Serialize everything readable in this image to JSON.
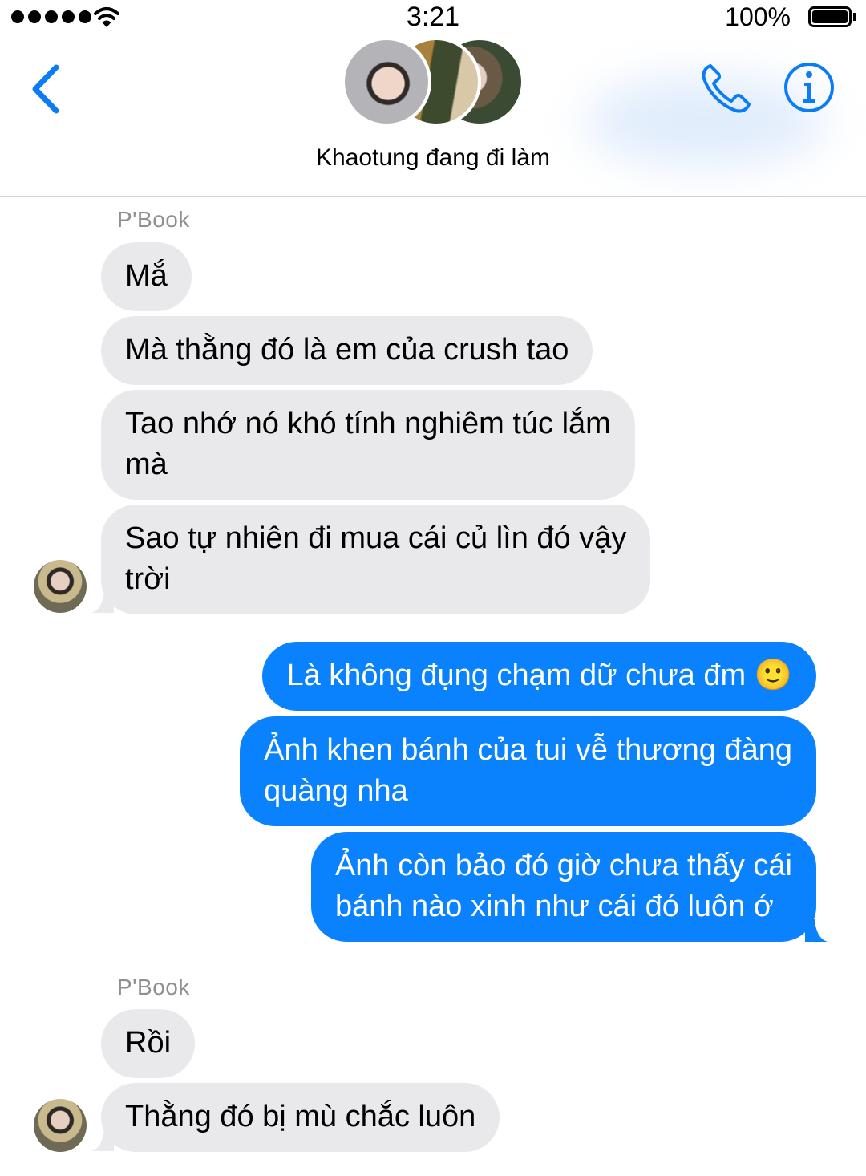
{
  "status_bar": {
    "time": "3:21",
    "battery_percent": "100%",
    "signal_bars": 5
  },
  "header": {
    "title": "Khaotung đang đi làm",
    "back_icon": "chevron-left-icon",
    "call_icon": "phone-icon",
    "info_icon": "info-icon",
    "accent_color": "#0a7cf5"
  },
  "colors": {
    "incoming_bubble": "#e9e9eb",
    "outgoing_bubble": "#0a82fd",
    "sender_name": "#8e8e93"
  },
  "messages": [
    {
      "sender": "P'Book",
      "direction": "incoming",
      "text": "Mắ"
    },
    {
      "direction": "incoming",
      "text": "Mà thằng đó là em của crush tao"
    },
    {
      "direction": "incoming",
      "text": "Tao nhớ nó khó tính nghiêm túc lắm\nmà"
    },
    {
      "direction": "incoming",
      "text": "Sao tự nhiên đi mua cái củ lìn đó vậy\ntrời"
    },
    {
      "direction": "outgoing",
      "text": "Là không đụng chạm dữ chưa đm 🙂"
    },
    {
      "direction": "outgoing",
      "text": "Ảnh khen bánh của tui vễ thương đàng\nquàng nha"
    },
    {
      "direction": "outgoing",
      "text": "Ảnh còn bảo đó giờ chưa thấy cái\nbánh nào xinh như cái đó luôn ớ"
    },
    {
      "sender": "P'Book",
      "direction": "incoming",
      "text": "Rồi"
    },
    {
      "direction": "incoming",
      "text": "Thằng đó bị mù chắc luôn"
    }
  ]
}
